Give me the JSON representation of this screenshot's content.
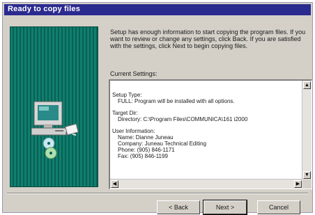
{
  "window": {
    "title": "Ready to copy files"
  },
  "intro": {
    "text": "Setup has enough information to start copying the program files. If you want to review or change any settings, click Back. If you are satisfied with the settings, click Next to begin copying files."
  },
  "settings": {
    "label": "Current Settings:",
    "setup_type_heading": "Setup Type:",
    "setup_type_value": "FULL: Program will be installed with all options.",
    "target_dir_heading": "Target Dir:",
    "target_dir_value": "Directory: C:\\Program Files\\COMMUNICA\\161 i2000",
    "user_info_heading": "User Information:",
    "user_name": "Name: Dianne Juneau",
    "user_company": "Company: Juneau Technical Editing",
    "user_phone": "Phone: (905) 846-1171",
    "user_fax": "Fax: (905) 846-1199"
  },
  "buttons": {
    "back": "< Back",
    "next": "Next >",
    "cancel": "Cancel"
  },
  "icons": {
    "computer": "computer-with-cd-icon",
    "scroll_up": "arrow-up-icon",
    "scroll_down": "arrow-down-icon",
    "scroll_left": "arrow-left-icon",
    "scroll_right": "arrow-right-icon"
  },
  "colors": {
    "titlebar": "#2b2a8f",
    "banner": "#0f7f6f",
    "dialog": "#d4d0c8"
  }
}
